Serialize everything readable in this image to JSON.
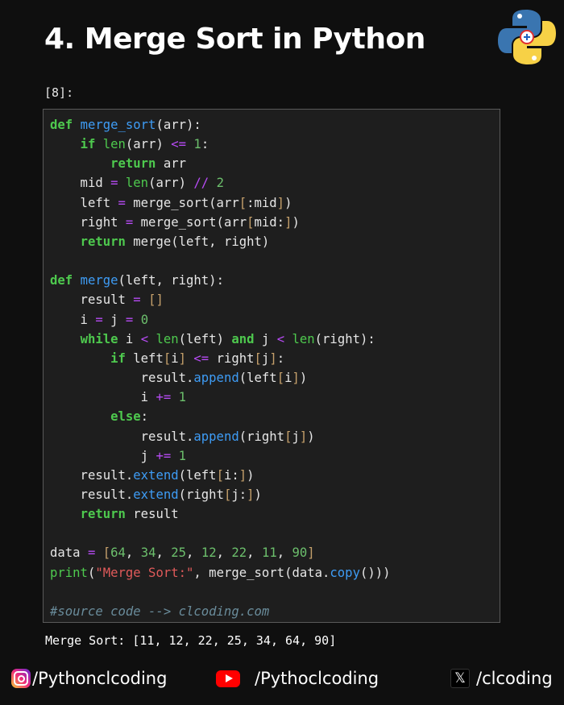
{
  "header": {
    "title": "4. Merge Sort in Python",
    "logo_icon": "python-logo-icon"
  },
  "cell": {
    "label": "[8]:",
    "lines": [
      "def merge_sort(arr):",
      "    if len(arr) <= 1:",
      "        return arr",
      "    mid = len(arr) // 2",
      "    left = merge_sort(arr[:mid])",
      "    right = merge_sort(arr[mid:])",
      "    return merge(left, right)",
      "",
      "def merge(left, right):",
      "    result = []",
      "    i = j = 0",
      "    while i < len(left) and j < len(right):",
      "        if left[i] <= right[j]:",
      "            result.append(left[i])",
      "            i += 1",
      "        else:",
      "            result.append(right[j])",
      "            j += 1",
      "    result.extend(left[i:])",
      "    result.extend(right[j:])",
      "    return result",
      "",
      "data = [64, 34, 25, 12, 22, 11, 90]",
      "print(\"Merge Sort:\", merge_sort(data.copy()))",
      "",
      "#source code --> clcoding.com"
    ],
    "output": "Merge Sort: [11, 12, 22, 25, 34, 64, 90]"
  },
  "footer": {
    "instagram": "/Pythonclcoding",
    "youtube": "/Pythoclcoding",
    "x": "/clcoding",
    "x_glyph": "𝕏"
  },
  "colors": {
    "background": "#0f0f0f",
    "code_bg": "#1e1e1e",
    "keyword": "#4ec94e",
    "function": "#3e9cf5",
    "operator": "#b74bf4",
    "number": "#6cbf6c",
    "string": "#e05a5a",
    "comment": "#6a8c9b"
  }
}
